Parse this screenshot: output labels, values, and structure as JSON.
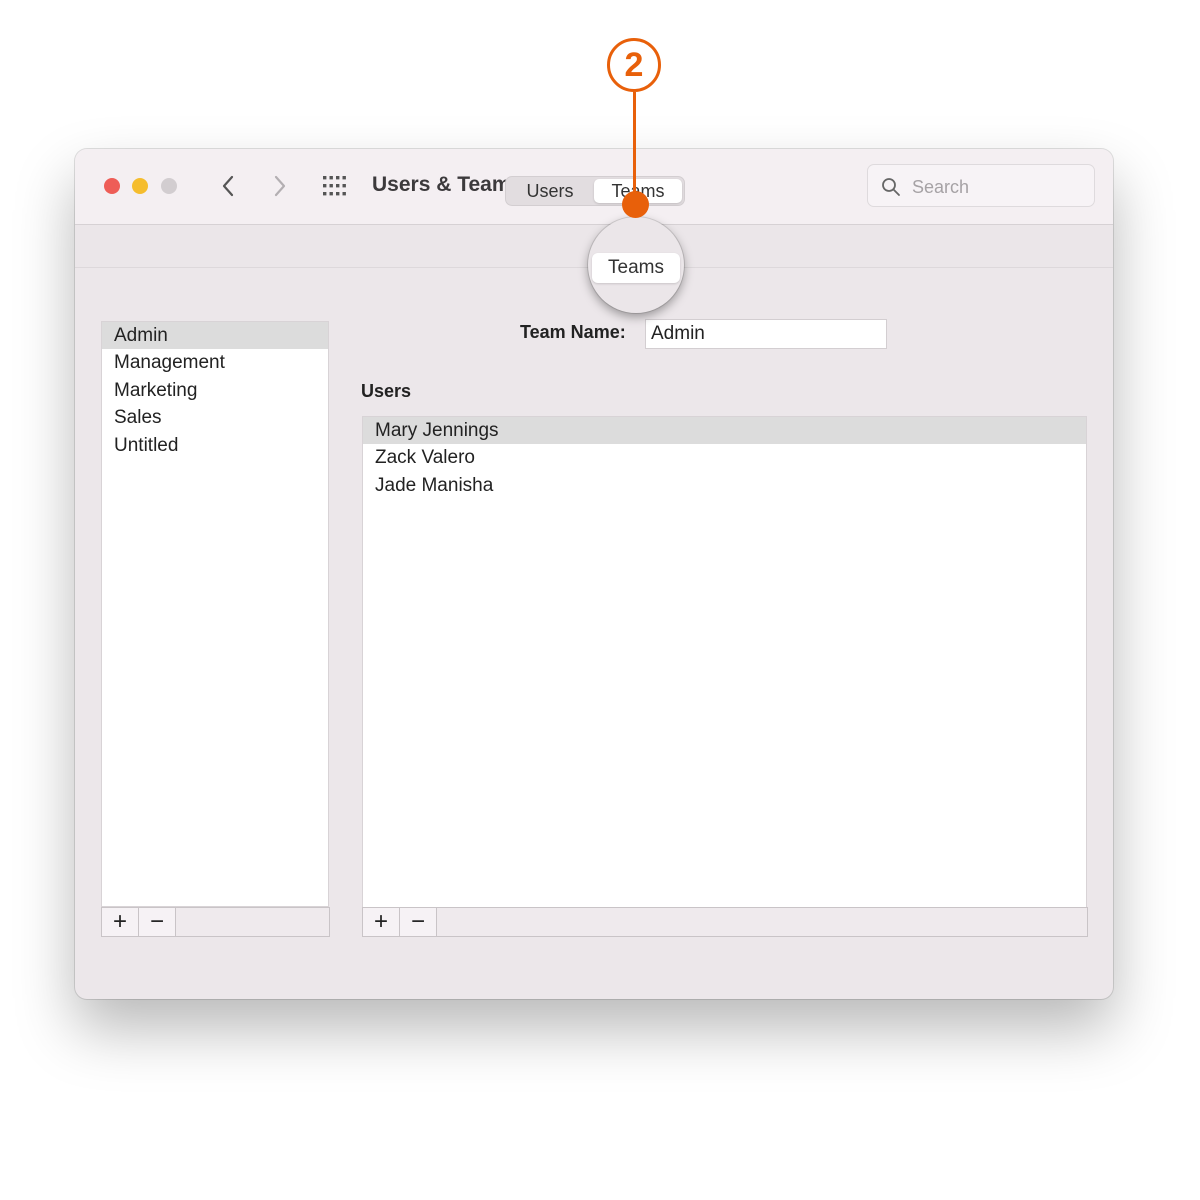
{
  "callout": {
    "number": "2"
  },
  "window": {
    "title": "Users & Teams",
    "search": {
      "placeholder": "Search"
    }
  },
  "tabs": {
    "items": [
      {
        "label": "Users",
        "selected": false
      },
      {
        "label": "Teams",
        "selected": true
      }
    ]
  },
  "teams_list": {
    "items": [
      "Admin",
      "Management",
      "Marketing",
      "Sales",
      "Untitled"
    ],
    "selected": "Admin"
  },
  "team_name": {
    "label": "Team Name:",
    "value": "Admin"
  },
  "users_section": {
    "heading": "Users",
    "items": [
      "Mary Jennings",
      "Zack Valero",
      "Jade Manisha"
    ],
    "selected": "Mary Jennings"
  },
  "footer_buttons": {
    "add": "+",
    "remove": "−"
  },
  "colors": {
    "accent": "#e8600a",
    "close": "#ee5d57",
    "minimize": "#f5bd2e",
    "zoom": "#d2cdd0"
  },
  "icons": [
    "back-chevron-icon",
    "forward-chevron-icon",
    "grid-icon",
    "search-icon"
  ]
}
